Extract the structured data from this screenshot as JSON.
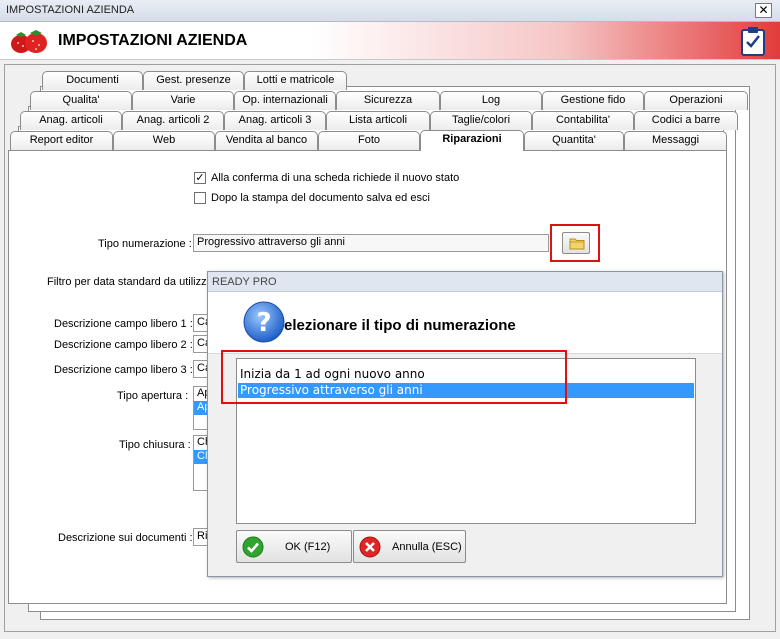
{
  "window": {
    "title": "IMPOSTAZIONI AZIENDA",
    "close": "✕"
  },
  "header": {
    "title": "IMPOSTAZIONI AZIENDA"
  },
  "tabs": {
    "row1": [
      "Documenti",
      "Gest. presenze",
      "Lotti e matricole"
    ],
    "row2": [
      "Qualita'",
      "Varie",
      "Op. internazionali",
      "Sicurezza",
      "Log",
      "Gestione fido",
      "Operazioni"
    ],
    "row3": [
      "Anag. articoli",
      "Anag. articoli 2",
      "Anag. articoli 3",
      "Lista articoli",
      "Taglie/colori",
      "Contabilita'",
      "Codici a barre"
    ],
    "row4": [
      "Report editor",
      "Web",
      "Vendita al banco",
      "Foto",
      "Riparazioni",
      "Quantita'",
      "Messaggi"
    ]
  },
  "form": {
    "chk1_label": "Alla conferma di una scheda richiede il nuovo stato",
    "chk1_checked": "✓",
    "chk2_label": "Dopo la stampa del documento salva ed esci",
    "tipo_numerazione_label": "Tipo numerazione :",
    "tipo_numerazione_value": "Progressivo attraverso gli anni",
    "filtro_label": "Filtro per data standard da utilizz",
    "campo1_label": "Descrizione campo libero 1 :",
    "campo1_value": "Ca",
    "campo2_label": "Descrizione campo libero 2 :",
    "campo2_value": "Ca",
    "campo3_label": "Descrizione campo libero 3 :",
    "campo3_value": "Ca",
    "tipo_apertura_label": "Tipo apertura :",
    "tipo_apertura_item1": "Ap",
    "tipo_apertura_item2": "Ap",
    "tipo_chiusura_label": "Tipo chiusura :",
    "tipo_chiusura_item1": "Ch",
    "tipo_chiusura_item2": "Ch",
    "descr_doc_label": "Descrizione sui documenti :",
    "descr_doc_value": "Ri"
  },
  "dialog": {
    "title": "READY PRO",
    "message": "Selezionare il tipo di numerazione",
    "options": [
      "Inizia da 1 ad ogni nuovo anno",
      "Progressivo attraverso gli anni"
    ],
    "selected_index": 1,
    "ok_label": "OK (F12)",
    "cancel_label": "Annulla (ESC)"
  }
}
